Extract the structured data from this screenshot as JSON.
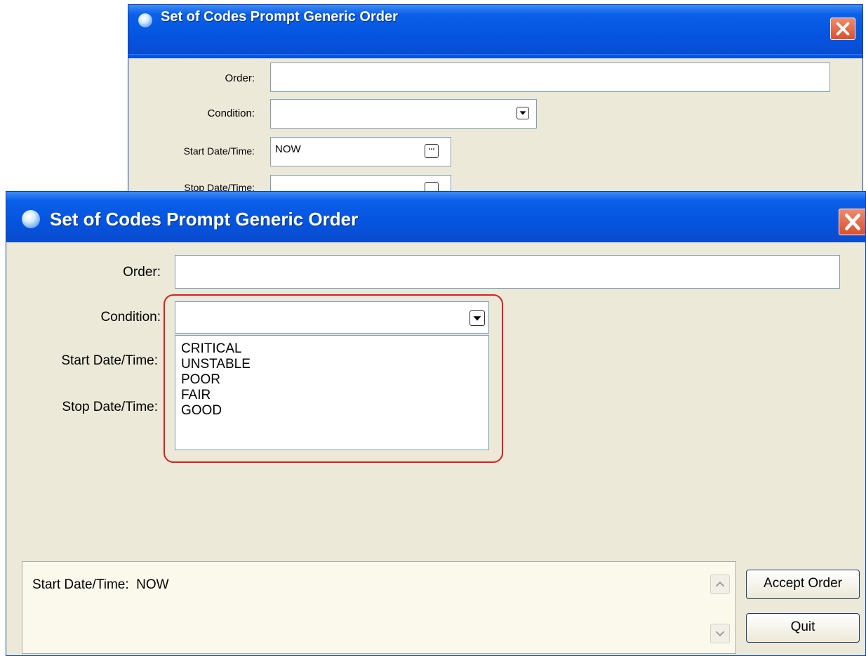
{
  "back_window": {
    "title": "Set of Codes Prompt Generic Order",
    "order_label": "Order:",
    "condition_label": "Condition:",
    "start_label": "Start Date/Time:",
    "start_value": "NOW",
    "stop_label": "Stop Date/Time:"
  },
  "front_window": {
    "title": "Set of Codes Prompt Generic Order",
    "order_label": "Order:",
    "condition_label": "Condition:",
    "start_label": "Start Date/Time:",
    "stop_label": "Stop Date/Time:",
    "condition_options": [
      "CRITICAL",
      "UNSTABLE",
      "POOR",
      "FAIR",
      "GOOD"
    ],
    "summary_text": "Start Date/Time:  NOW",
    "accept_button": "Accept Order",
    "quit_button": "Quit",
    "ellipsis": "..."
  },
  "colors": {
    "titlebar": "#0554e0",
    "window_bg": "#ece9d8",
    "highlight": "#e21b1b",
    "close": "#d9502c"
  },
  "icons": [
    "app-icon",
    "close-icon",
    "dropdown-arrow-icon",
    "scroll-up-icon",
    "scroll-down-icon"
  ]
}
